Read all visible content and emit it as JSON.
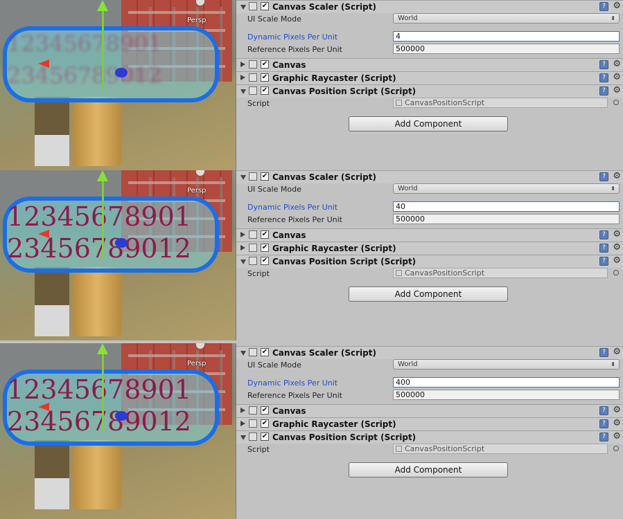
{
  "panels": [
    {
      "scene": {
        "persp_label": "Persp",
        "numbers_line1": "12345678901",
        "numbers_line2": "23456789012"
      },
      "inspector": {
        "canvas_scaler": {
          "title": "Canvas Scaler (Script)",
          "enabled": "✔",
          "help": "?",
          "settings": "⚙"
        },
        "ui_scale_mode": {
          "label": "UI Scale Mode",
          "value": "World",
          "arrow": "⬍"
        },
        "dynamic_ppu": {
          "label": "Dynamic Pixels Per Unit",
          "value": "4"
        },
        "reference_ppu": {
          "label": "Reference Pixels Per Unit",
          "value": "500000"
        },
        "canvas": {
          "title": "Canvas",
          "enabled": "✔",
          "help": "?",
          "settings": "⚙"
        },
        "graphic_raycaster": {
          "title": "Graphic Raycaster (Script)",
          "enabled": "✔",
          "help": "?",
          "settings": "⚙"
        },
        "canvas_position": {
          "title": "Canvas Position Script (Script)",
          "enabled": "✔",
          "help": "?",
          "settings": "⚙"
        },
        "script_field": {
          "label": "Script",
          "value": "CanvasPositionScript"
        },
        "add_component": "Add Component"
      }
    },
    {
      "scene": {
        "persp_label": "Persp",
        "numbers_line1": "12345678901",
        "numbers_line2": "23456789012"
      },
      "inspector": {
        "canvas_scaler": {
          "title": "Canvas Scaler (Script)",
          "enabled": "✔",
          "help": "?",
          "settings": "⚙"
        },
        "ui_scale_mode": {
          "label": "UI Scale Mode",
          "value": "World",
          "arrow": "⬍"
        },
        "dynamic_ppu": {
          "label": "Dynamic Pixels Per Unit",
          "value": "40"
        },
        "reference_ppu": {
          "label": "Reference Pixels Per Unit",
          "value": "500000"
        },
        "canvas": {
          "title": "Canvas",
          "enabled": "✔",
          "help": "?",
          "settings": "⚙"
        },
        "graphic_raycaster": {
          "title": "Graphic Raycaster (Script)",
          "enabled": "✔",
          "help": "?",
          "settings": "⚙"
        },
        "canvas_position": {
          "title": "Canvas Position Script (Script)",
          "enabled": "✔",
          "help": "?",
          "settings": "⚙"
        },
        "script_field": {
          "label": "Script",
          "value": "CanvasPositionScript"
        },
        "add_component": "Add Component"
      }
    },
    {
      "scene": {
        "persp_label": "Persp",
        "numbers_line1": "12345678901",
        "numbers_line2": "23456789012"
      },
      "inspector": {
        "canvas_scaler": {
          "title": "Canvas Scaler (Script)",
          "enabled": "✔",
          "help": "?",
          "settings": "⚙"
        },
        "ui_scale_mode": {
          "label": "UI Scale Mode",
          "value": "World",
          "arrow": "⬍"
        },
        "dynamic_ppu": {
          "label": "Dynamic Pixels Per Unit",
          "value": "400"
        },
        "reference_ppu": {
          "label": "Reference Pixels Per Unit",
          "value": "500000"
        },
        "canvas": {
          "title": "Canvas",
          "enabled": "✔",
          "help": "?",
          "settings": "⚙"
        },
        "graphic_raycaster": {
          "title": "Graphic Raycaster (Script)",
          "enabled": "✔",
          "help": "?",
          "settings": "⚙"
        },
        "canvas_position": {
          "title": "Canvas Position Script (Script)",
          "enabled": "✔",
          "help": "?",
          "settings": "⚙"
        },
        "script_field": {
          "label": "Script",
          "value": "CanvasPositionScript"
        },
        "add_component": "Add Component"
      }
    }
  ],
  "colors": {
    "inspector_bg": "#c2c2c2",
    "focus_label_blue": "#1b4fcc",
    "canvas_bubble_blue": "#1a6ee8",
    "text_number_color": "#8a1c4c"
  }
}
